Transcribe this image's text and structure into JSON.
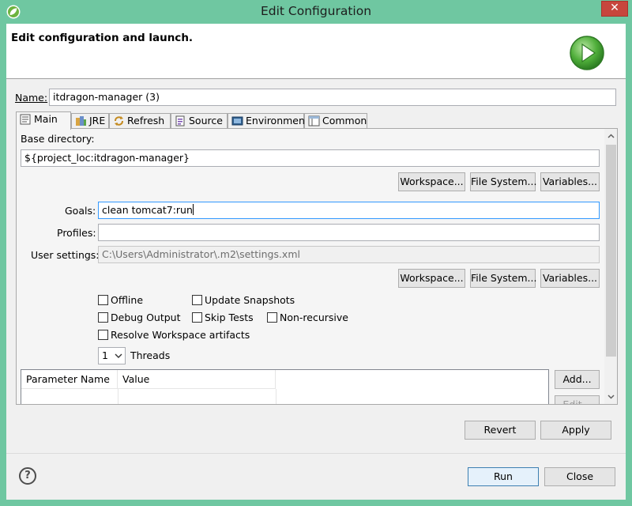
{
  "window": {
    "title": "Edit Configuration",
    "close_glyph": "✕",
    "accent": "#6fc7a1"
  },
  "header": {
    "title": "Edit configuration and launch.",
    "logo_icon": "run-launch-icon"
  },
  "name": {
    "label": "Name:",
    "value": "itdragon-manager (3)"
  },
  "tabs": [
    {
      "label": "Main",
      "icon": "main-tab-icon",
      "active": true
    },
    {
      "label": "JRE",
      "icon": "jre-icon"
    },
    {
      "label": "Refresh",
      "icon": "refresh-icon"
    },
    {
      "label": "Source",
      "icon": "source-icon"
    },
    {
      "label": "Environment",
      "icon": "environment-icon"
    },
    {
      "label": "Common",
      "icon": "common-icon"
    }
  ],
  "main": {
    "base_dir_label": "Base directory:",
    "base_dir_value": "${project_loc:itdragon-manager}",
    "workspace_btn": "Workspace...",
    "filesystem_btn": "File System...",
    "variables_btn": "Variables...",
    "goals_label": "Goals:",
    "goals_value": "clean tomcat7:run",
    "profiles_label": "Profiles:",
    "profiles_value": "",
    "user_settings_label": "User settings:",
    "user_settings_value": "C:\\Users\\Administrator\\.m2\\settings.xml",
    "checkboxes": {
      "offline": "Offline",
      "update_snapshots": "Update Snapshots",
      "debug_output": "Debug Output",
      "skip_tests": "Skip Tests",
      "non_recursive": "Non-recursive",
      "resolve_workspace": "Resolve Workspace artifacts"
    },
    "threads_value": "1",
    "threads_label": "Threads",
    "params_col_name": "Parameter Name",
    "params_col_value": "Value",
    "add_btn": "Add...",
    "edit_btn": "Edit..."
  },
  "footer": {
    "revert": "Revert",
    "apply": "Apply",
    "run": "Run",
    "close": "Close",
    "help_glyph": "?"
  }
}
